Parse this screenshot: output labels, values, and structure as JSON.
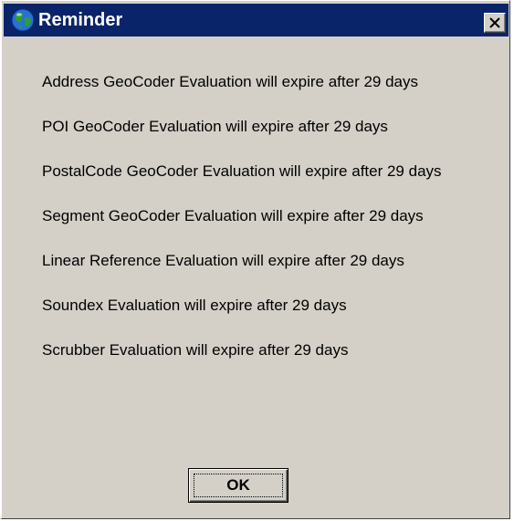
{
  "window": {
    "title": "Reminder",
    "title_icon": "globe-icon",
    "close_icon": "close-icon",
    "colors": {
      "titlebar": "#0a246a",
      "face": "#d4d0c8",
      "text": "#000000"
    }
  },
  "messages": [
    "Address GeoCoder Evaluation will expire after 29 days",
    "POI GeoCoder Evaluation will expire after 29 days",
    "PostalCode GeoCoder Evaluation will expire after 29 days",
    "Segment GeoCoder Evaluation will expire after 29 days",
    "Linear Reference Evaluation will expire after 29 days",
    "Soundex Evaluation will expire after 29 days",
    "Scrubber Evaluation will expire after 29 days"
  ],
  "ok_button": {
    "label": "OK"
  }
}
